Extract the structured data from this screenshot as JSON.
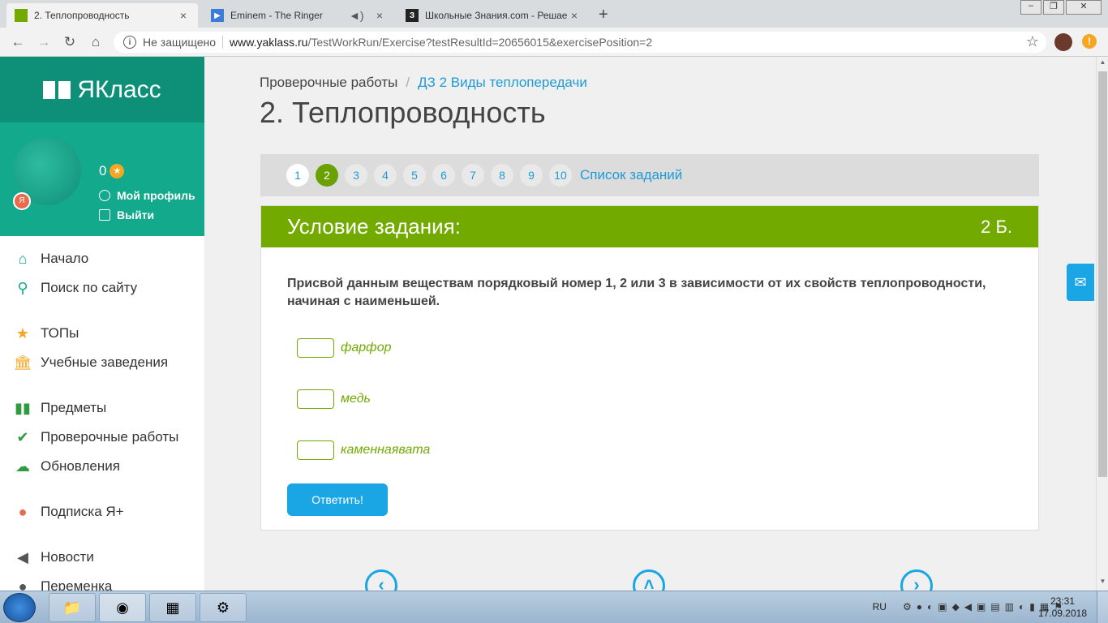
{
  "browser": {
    "tabs": [
      {
        "title": "2. Теплопроводность",
        "active": true,
        "icon_color": "#72aa00"
      },
      {
        "title": "Eminem - The Ringer",
        "active": false,
        "icon_color": "#3d7bd9"
      },
      {
        "title": "Школьные Знания.com - Решае",
        "active": false,
        "icon_color": "#222222"
      }
    ],
    "security_label": "Не защищено",
    "url_host": "www.yaklass.ru",
    "url_path": "/TestWorkRun/Exercise?testResultId=20656015&exercisePosition=2"
  },
  "sidebar": {
    "brand": "ЯКласс",
    "points": "0",
    "profile_link": "Мой профиль",
    "logout_link": "Выйти",
    "menu": [
      {
        "label": "Начало",
        "icon": "home-icon",
        "color": "#12a98d"
      },
      {
        "label": "Поиск по сайту",
        "icon": "search-icon",
        "color": "#12a98d"
      },
      {
        "label": "ТОПы",
        "icon": "star-icon",
        "color": "#f5a623"
      },
      {
        "label": "Учебные заведения",
        "icon": "building-icon",
        "color": "#f5a623"
      },
      {
        "label": "Предметы",
        "icon": "book-icon",
        "color": "#2e9b3e"
      },
      {
        "label": "Проверочные работы",
        "icon": "check-circle-icon",
        "color": "#2e9b3e"
      },
      {
        "label": "Обновления",
        "icon": "cloud-upload-icon",
        "color": "#2e9b3e"
      },
      {
        "label": "Подписка Я+",
        "icon": "subscription-icon",
        "color": "#e96b4d"
      },
      {
        "label": "Новости",
        "icon": "megaphone-icon",
        "color": "#555555"
      },
      {
        "label": "Переменка",
        "icon": "person-icon",
        "color": "#555555"
      }
    ]
  },
  "main": {
    "breadcrumb_root": "Проверочные работы",
    "breadcrumb_separator": "/",
    "breadcrumb_current": "ДЗ 2 Виды теплопередачи",
    "title": "2. Теплопроводность",
    "pager": {
      "numbers": [
        "1",
        "2",
        "3",
        "4",
        "5",
        "6",
        "7",
        "8",
        "9",
        "10"
      ],
      "active": "2",
      "list_link": "Список заданий"
    },
    "task": {
      "header": "Условие задания:",
      "points": "2 Б.",
      "text": "Присвой данным веществам порядковый номер 1, 2 или 3 в зависимости от их свойств теплопроводности, начиная с наименьшей.",
      "answers": [
        {
          "label": "фарфор",
          "value": ""
        },
        {
          "label": "медь",
          "value": ""
        },
        {
          "label": "каменнаявата",
          "value": ""
        }
      ],
      "submit_label": "Ответить!"
    }
  },
  "taskbar": {
    "lang": "RU",
    "time": "23:31",
    "date": "17.09.2018"
  },
  "colors": {
    "accent_green": "#72aa00",
    "accent_blue": "#1aa5e4",
    "sidebar_teal": "#12a98d"
  }
}
